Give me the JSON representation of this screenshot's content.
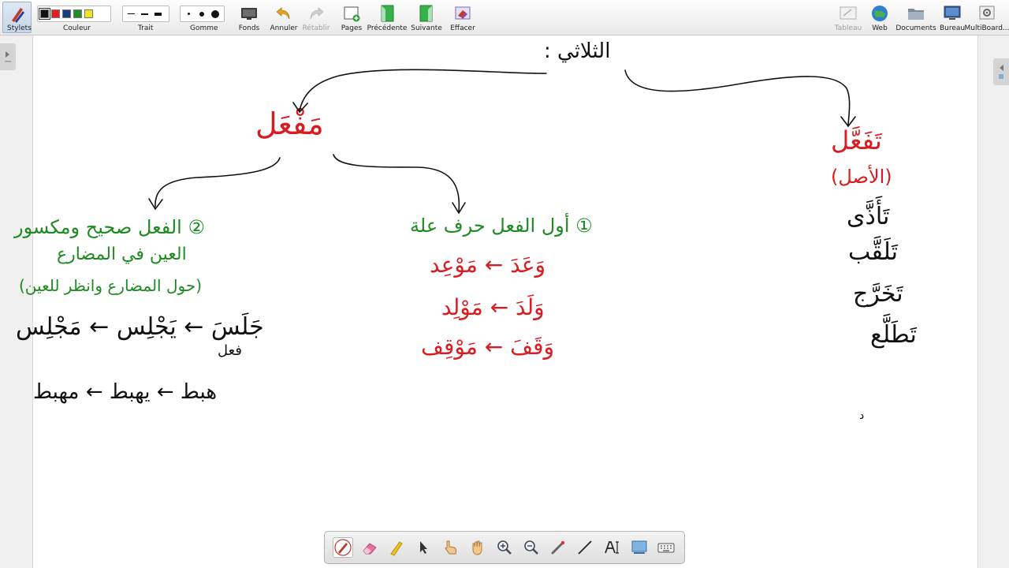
{
  "toolbar": {
    "stylets": "Stylets",
    "couleur": "Couleur",
    "trait": "Trait",
    "gomme": "Gomme",
    "fonds": "Fonds",
    "annuler": "Annuler",
    "retablir": "Rétablir",
    "pages": "Pages",
    "precedente": "Précédente",
    "suivante": "Suivante",
    "effacer": "Effacer",
    "tableau": "Tableau",
    "web": "Web",
    "documents": "Documents",
    "bureau": "Bureau",
    "multiboard": "MultiBoard..."
  },
  "colors": {
    "swatches": [
      "#111111",
      "#e3201f",
      "#173d7a",
      "#1e8f2a",
      "#f4e41d"
    ],
    "ink_black": "#111111",
    "ink_red": "#d81d22",
    "ink_green": "#1f8a22"
  },
  "board": {
    "root": "الثلاثي :",
    "right_branch": {
      "title": "تَفَعَّل",
      "subtitle": "(الأصل)",
      "examples": [
        "تَأَذَّى",
        "تَلَقَّب",
        "تَخَرَّج",
        "تَطَلَّع"
      ]
    },
    "left_branch": {
      "title": "مَفْعَل",
      "case1": {
        "heading": "① أول الفعل حرف علة",
        "examples": [
          "وَعَدَ ← مَوْعِد",
          "وَلَدَ ← مَوْلِد",
          "وَقَفَ ← مَوْقِف"
        ]
      },
      "case2": {
        "heading_line1": "② الفعل صحيح ومكسور",
        "heading_line2": "العين في المضارع",
        "heading_line3": "(حول المضارع وانظر للعين)",
        "example1": "جَلَسَ ← يَجْلِس ← مَجْلِس",
        "example1_note": "فعل",
        "example2": "هبط ← يهبط ← مهبط"
      }
    },
    "stray_mark": "د"
  }
}
